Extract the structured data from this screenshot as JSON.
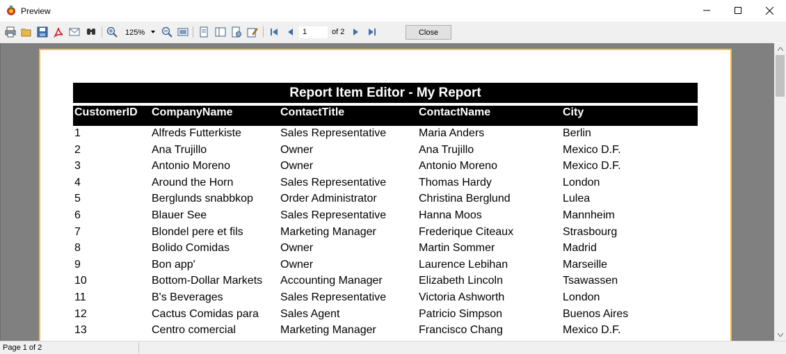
{
  "window": {
    "title": "Preview"
  },
  "toolbar": {
    "zoom": "125%",
    "page_number": "1",
    "of_pages": "of 2",
    "close_label": "Close"
  },
  "report": {
    "title": "Report Item Editor - My Report",
    "columns": [
      "CustomerID",
      "CompanyName",
      "ContactTitle",
      "ContactName",
      "City"
    ],
    "rows": [
      [
        "1",
        "Alfreds Futterkiste",
        "Sales Representative",
        "Maria Anders",
        "Berlin"
      ],
      [
        "2",
        "Ana Trujillo",
        "Owner",
        "Ana Trujillo",
        "Mexico D.F."
      ],
      [
        "3",
        "Antonio Moreno",
        "Owner",
        "Antonio Moreno",
        "Mexico D.F."
      ],
      [
        "4",
        "Around the Horn",
        "Sales Representative",
        "Thomas Hardy",
        "London"
      ],
      [
        "5",
        "Berglunds snabbkop",
        "Order Administrator",
        "Christina Berglund",
        "Lulea"
      ],
      [
        "6",
        "Blauer See",
        "Sales Representative",
        "Hanna Moos",
        "Mannheim"
      ],
      [
        "7",
        "Blondel pere et fils",
        "Marketing Manager",
        "Frederique Citeaux",
        "Strasbourg"
      ],
      [
        "8",
        "Bolido Comidas",
        "Owner",
        "Martin Sommer",
        "Madrid"
      ],
      [
        "9",
        "Bon app'",
        "Owner",
        "Laurence Lebihan",
        "Marseille"
      ],
      [
        "10",
        "Bottom-Dollar Markets",
        "Accounting Manager",
        "Elizabeth Lincoln",
        "Tsawassen"
      ],
      [
        "11",
        "B's Beverages",
        "Sales Representative",
        "Victoria Ashworth",
        "London"
      ],
      [
        "12",
        "Cactus Comidas para",
        "Sales Agent",
        "Patricio Simpson",
        "Buenos Aires"
      ],
      [
        "13",
        "Centro comercial",
        "Marketing Manager",
        "Francisco Chang",
        "Mexico D.F."
      ]
    ]
  },
  "status": {
    "text": "Page 1 of 2"
  },
  "icons": [
    "print-icon",
    "open-icon",
    "save-icon",
    "pdf-icon",
    "email-icon",
    "find-icon",
    "zoom-in-icon",
    "zoom-out-icon",
    "whole-page-icon",
    "single-page-icon",
    "multi-page-icon",
    "settings-icon",
    "edit-icon",
    "first-page-icon",
    "prev-page-icon",
    "next-page-icon",
    "last-page-icon"
  ],
  "colors": {
    "page_border": "#f4b942",
    "viewport_bg": "#808080",
    "header_bg": "#000000"
  }
}
